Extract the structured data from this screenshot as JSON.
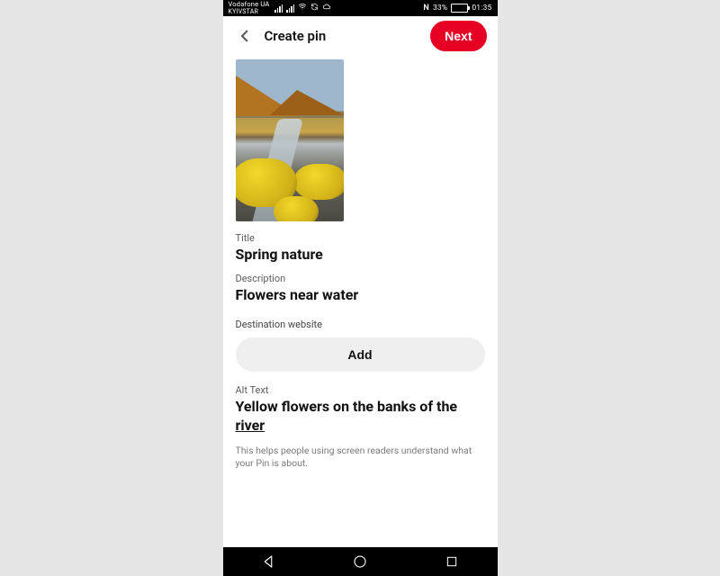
{
  "status_bar": {
    "carrier_line1": "Vodafone UA",
    "carrier_line2": "KYIVSTAR",
    "battery_pct": "33%",
    "time": "01:35",
    "nfc_glyph": "№"
  },
  "app_bar": {
    "title": "Create pin",
    "next_label": "Next"
  },
  "pin": {
    "title_label": "Title",
    "title_value": "Spring nature",
    "description_label": "Description",
    "description_value": "Flowers near water",
    "destination_label": "Destination website",
    "add_label": "Add",
    "alt_label": "Alt Text",
    "alt_value_part1": "Yellow flowers on the banks of the ",
    "alt_value_underlined": "river",
    "helper": "This helps people using screen readers understand what your Pin is about."
  },
  "colors": {
    "accent": "#e60023",
    "button_bg": "#efefef"
  }
}
